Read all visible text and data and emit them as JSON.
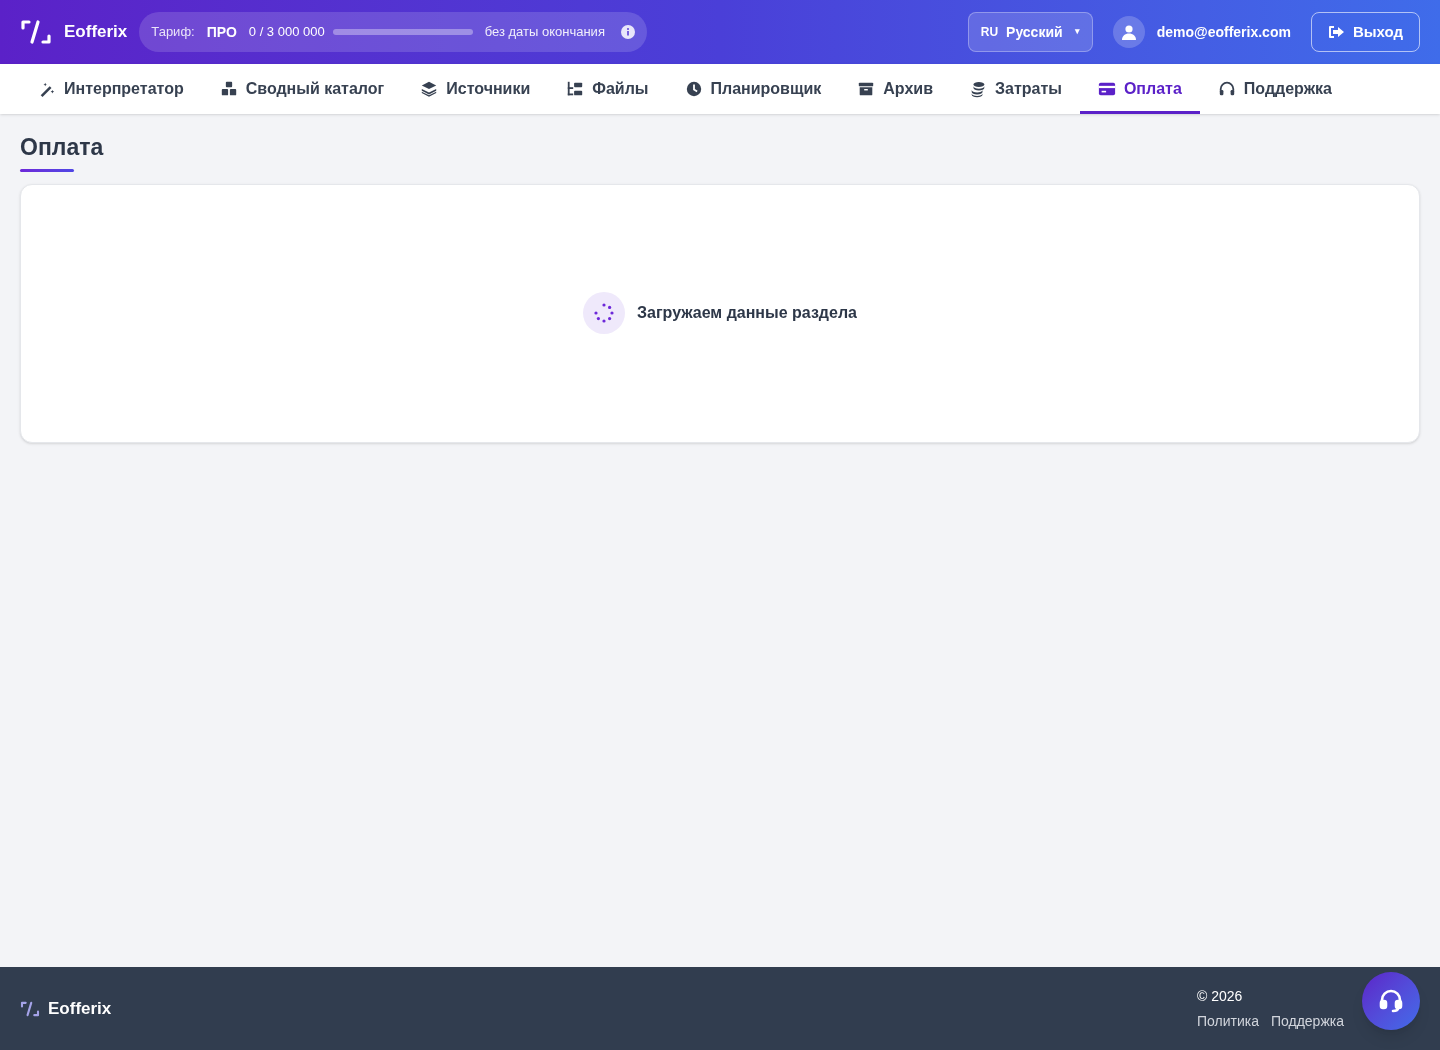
{
  "header": {
    "brand": "Eofferix",
    "plan": {
      "label": "Тариф:",
      "name": "ПРО",
      "usage": "0 / 3 000 000",
      "level": 0,
      "expiry": "без даты окончания"
    },
    "language": {
      "code": "RU",
      "name": "Русский",
      "caret": "▾"
    },
    "user": {
      "email": "demo@eofferix.com"
    },
    "logout": "Выход"
  },
  "nav": [
    {
      "label": "Интерпретатор",
      "selected": false
    },
    {
      "label": "Сводный каталог",
      "selected": false
    },
    {
      "label": "Источники",
      "selected": false
    },
    {
      "label": "Файлы",
      "selected": false
    },
    {
      "label": "Планировщик",
      "selected": false
    },
    {
      "label": "Архив",
      "selected": false
    },
    {
      "label": "Затраты",
      "selected": false
    },
    {
      "label": "Оплата",
      "selected": true
    },
    {
      "label": "Поддержка",
      "selected": false
    }
  ],
  "page": {
    "title": "Оплата",
    "loading": "Загружаем данные раздела"
  },
  "footer": {
    "brand": "Eofferix",
    "copyright": "© 2026",
    "links": [
      "Политика",
      "Поддержка"
    ]
  }
}
